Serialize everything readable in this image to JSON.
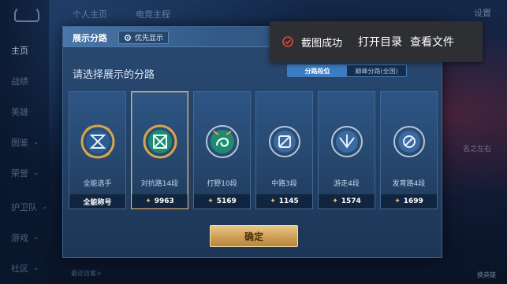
{
  "background": {
    "top_tabs": [
      "个人主页",
      "电竞主程"
    ],
    "settings_label": "设置",
    "nav_items": [
      "主页",
      "战绩",
      "英雄",
      "图鉴",
      "荣誉",
      "护卫队",
      "游戏",
      "社区"
    ],
    "right_text": "名之左右",
    "bottom_left_text": "最近访客>",
    "bottom_right_text": "换英雄"
  },
  "dialog": {
    "title": "展示分路",
    "priority_label": "优先显示",
    "subtitle": "请选择展示的分路",
    "segments": [
      {
        "label": "分路段位",
        "active": true
      },
      {
        "label": "巅峰分路(全国)",
        "active": false
      }
    ],
    "cards": [
      {
        "name": "全能选手",
        "stat_label": "全能称号",
        "has_bolt": false,
        "emblem": "all-round",
        "selected": false
      },
      {
        "name": "对抗路14段",
        "stat_label": "9963",
        "has_bolt": true,
        "emblem": "clash-lane",
        "selected": true
      },
      {
        "name": "打野10段",
        "stat_label": "5169",
        "has_bolt": true,
        "emblem": "jungle",
        "selected": false
      },
      {
        "name": "中路3段",
        "stat_label": "1145",
        "has_bolt": true,
        "emblem": "mid-lane",
        "selected": false
      },
      {
        "name": "游走4段",
        "stat_label": "1574",
        "has_bolt": true,
        "emblem": "roam",
        "selected": false
      },
      {
        "name": "发育路4段",
        "stat_label": "1699",
        "has_bolt": true,
        "emblem": "farm-lane",
        "selected": false
      }
    ],
    "confirm_label": "确定"
  },
  "toast": {
    "message": "截图成功",
    "open_folder_label": "打开目录",
    "view_file_label": "查看文件"
  },
  "colors": {
    "accent_gold": "#e2b97a",
    "active_segment": "#3b7dc6",
    "toast_bg": "#2e2f33",
    "success_red": "#e0453a"
  }
}
